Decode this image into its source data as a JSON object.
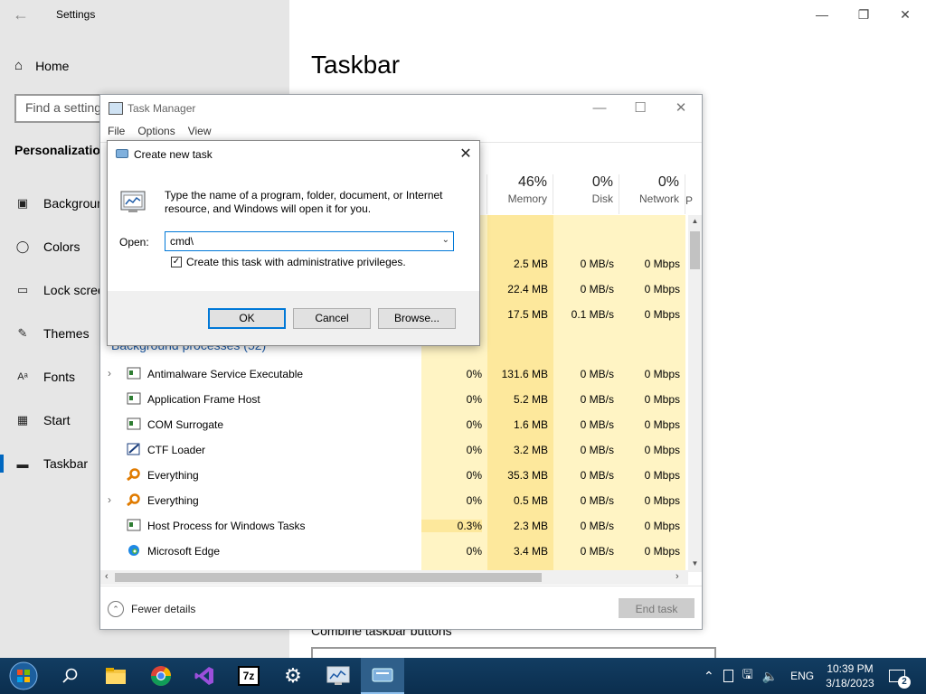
{
  "settings": {
    "title": "Settings",
    "home": "Home",
    "search_placeholder": "Find a setting",
    "section": "Personalization",
    "nav": [
      "Background",
      "Colors",
      "Lock screen",
      "Themes",
      "Fonts",
      "Start",
      "Taskbar"
    ],
    "page_title": "Taskbar",
    "combine_label": "Combine taskbar buttons"
  },
  "task_manager": {
    "title": "Task Manager",
    "menu": [
      "File",
      "Options",
      "View"
    ],
    "columns": {
      "memory": {
        "pct": "46%",
        "label": "Memory"
      },
      "disk": {
        "pct": "0%",
        "label": "Disk"
      },
      "network": {
        "pct": "0%",
        "label": "Network"
      },
      "power_partial": "P"
    },
    "top_rows": [
      {
        "memory": "2.5 MB",
        "disk": "0 MB/s",
        "network": "0 Mbps"
      },
      {
        "memory": "22.4 MB",
        "disk": "0 MB/s",
        "network": "0 Mbps"
      },
      {
        "memory": "17.5 MB",
        "disk": "0.1 MB/s",
        "network": "0 Mbps"
      }
    ],
    "background_section": "Background processes (52)",
    "processes": [
      {
        "name": "Antimalware Service Executable",
        "cpu": "0%",
        "memory": "131.6 MB",
        "disk": "0 MB/s",
        "network": "0 Mbps",
        "expandable": true
      },
      {
        "name": "Application Frame Host",
        "cpu": "0%",
        "memory": "5.2 MB",
        "disk": "0 MB/s",
        "network": "0 Mbps",
        "expandable": false
      },
      {
        "name": "COM Surrogate",
        "cpu": "0%",
        "memory": "1.6 MB",
        "disk": "0 MB/s",
        "network": "0 Mbps",
        "expandable": false
      },
      {
        "name": "CTF Loader",
        "cpu": "0%",
        "memory": "3.2 MB",
        "disk": "0 MB/s",
        "network": "0 Mbps",
        "expandable": false
      },
      {
        "name": "Everything",
        "cpu": "0%",
        "memory": "35.3 MB",
        "disk": "0 MB/s",
        "network": "0 Mbps",
        "expandable": false
      },
      {
        "name": "Everything",
        "cpu": "0%",
        "memory": "0.5 MB",
        "disk": "0 MB/s",
        "network": "0 Mbps",
        "expandable": true
      },
      {
        "name": "Host Process for Windows Tasks",
        "cpu": "0.3%",
        "memory": "2.3 MB",
        "disk": "0 MB/s",
        "network": "0 Mbps",
        "expandable": false
      },
      {
        "name": "Microsoft Edge",
        "cpu": "0%",
        "memory": "3.4 MB",
        "disk": "0 MB/s",
        "network": "0 Mbps",
        "expandable": false
      }
    ],
    "fewer_details": "Fewer details",
    "end_task": "End task"
  },
  "run_dialog": {
    "title": "Create new task",
    "description": "Type the name of a program, folder, document, or Internet resource, and Windows will open it for you.",
    "open_label": "Open:",
    "open_value": "cmd\\",
    "admin_checkbox": "Create this task with administrative privileges.",
    "admin_checked": true,
    "ok": "OK",
    "cancel": "Cancel",
    "browse": "Browse..."
  },
  "taskbar": {
    "language": "ENG",
    "time": "10:39 PM",
    "date": "3/18/2023",
    "notification_count": "2",
    "apps": [
      "start-orb",
      "search",
      "file-explorer",
      "chrome",
      "visual-studio",
      "7zip",
      "settings",
      "task-manager",
      "run"
    ]
  },
  "colors": {
    "accent": "#0078d7",
    "heat_light": "#fff4c4",
    "heat_mid": "#fde89c",
    "taskbar": "#0e3a5f"
  }
}
